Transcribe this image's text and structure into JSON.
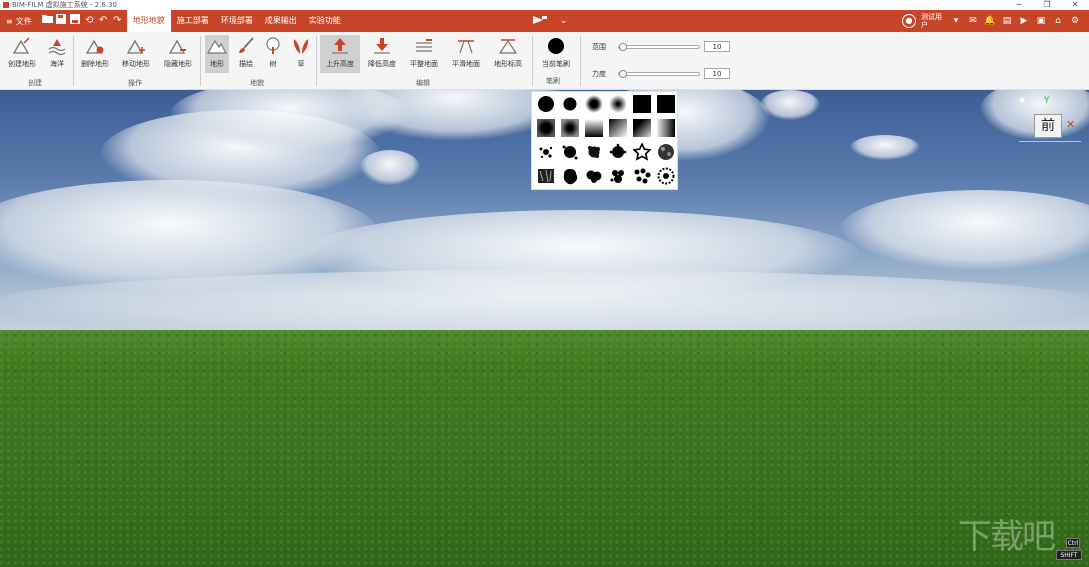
{
  "window": {
    "title": "BIM-FILM 虚拟施工系统 - 2.6.30",
    "controls": [
      "─",
      "❐",
      "✕"
    ]
  },
  "menubar": {
    "file_label": "文件",
    "tabs": [
      {
        "label": "地形地貌",
        "active": true
      },
      {
        "label": "施工部署",
        "active": false
      },
      {
        "label": "环境部署",
        "active": false
      },
      {
        "label": "成果输出",
        "active": false
      },
      {
        "label": "实验功能",
        "active": false
      }
    ],
    "user_label": "测试用户",
    "accent_color": "#c8452a"
  },
  "ribbon": {
    "groups": {
      "create": "创建",
      "operate": "操作",
      "terrain": "地貌",
      "edit": "编辑",
      "brush": "笔刷"
    },
    "buttons": {
      "create_terrain": "创建地形",
      "ocean": "海洋",
      "delete_terrain": "删除地形",
      "move_terrain": "移动地形",
      "hide_terrain": "隐藏地形",
      "terrain": "地形",
      "paint": "描绘",
      "tree": "树",
      "grass": "草",
      "raise_height": "上升高度",
      "lower_height": "降低高度",
      "flatten_ground": "平整地面",
      "smooth_ground": "平滑地面",
      "terrain_elevation": "地形标高",
      "current_brush": "当前笔刷"
    },
    "range": {
      "label": "范围",
      "value": "10"
    },
    "strength": {
      "label": "力度",
      "value": "10"
    }
  },
  "viewport": {
    "view_label": "前",
    "axis_y": "Y",
    "axis_x": "✕",
    "watermark": "下载吧",
    "key_ctrl": "Ctrl",
    "key_shift": "SHIFT"
  }
}
